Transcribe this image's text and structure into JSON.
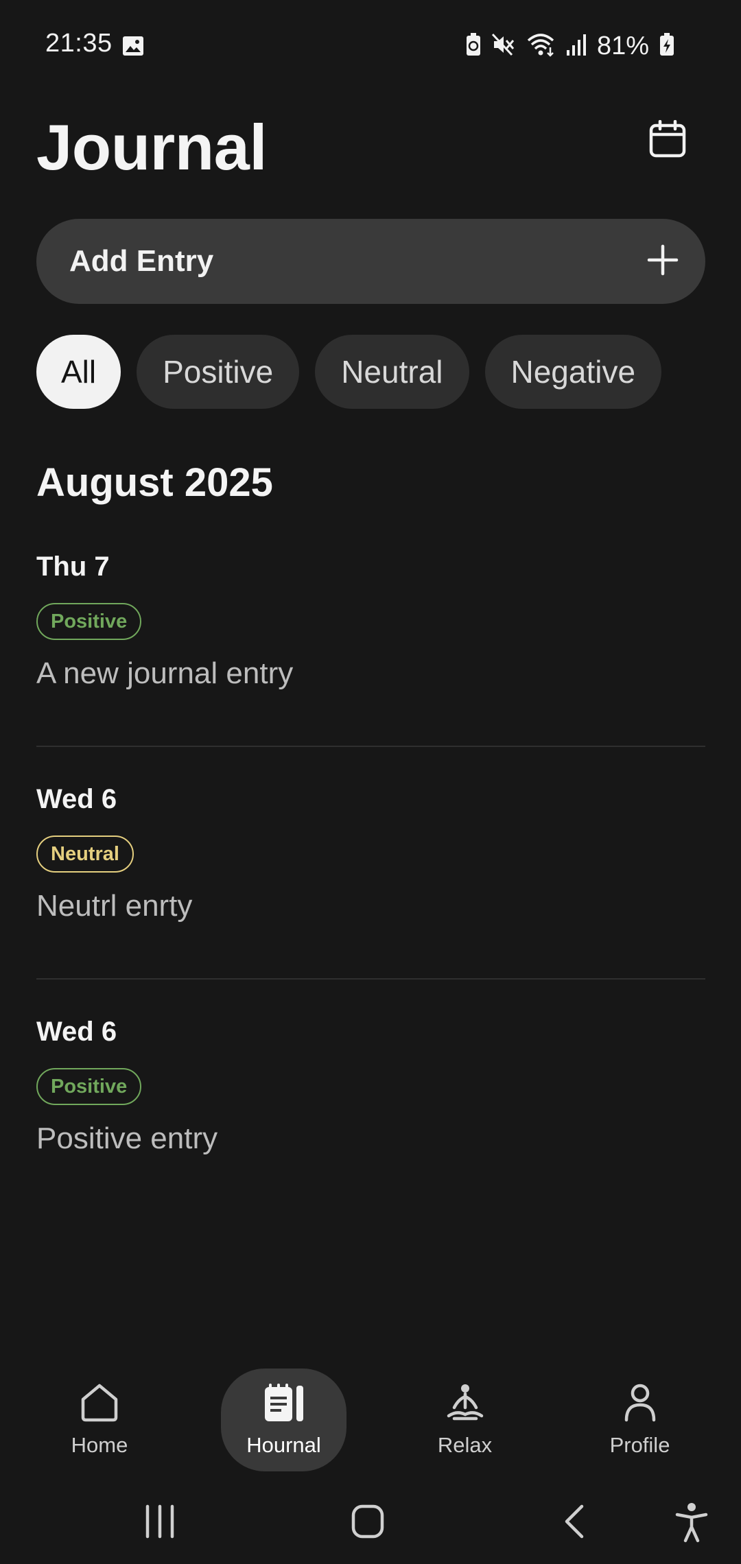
{
  "status_bar": {
    "time": "21:35",
    "battery_percent": "81%",
    "icons": [
      "image-icon",
      "battery-saver-icon",
      "mute-icon",
      "wifi-icon",
      "signal-icon",
      "battery-charging-icon"
    ]
  },
  "header": {
    "title": "Journal",
    "calendar_icon": "calendar-icon"
  },
  "add_entry": {
    "label": "Add Entry",
    "icon": "plus-icon"
  },
  "filters": [
    {
      "label": "All",
      "active": true
    },
    {
      "label": "Positive",
      "active": false
    },
    {
      "label": "Neutral",
      "active": false
    },
    {
      "label": "Negative",
      "active": false
    }
  ],
  "month": "August 2025",
  "entries": [
    {
      "date": "Thu 7",
      "mood": "Positive",
      "text": "A new journal entry"
    },
    {
      "date": "Wed 6",
      "mood": "Neutral",
      "text": "Neutrl enrty"
    },
    {
      "date": "Wed 6",
      "mood": "Positive",
      "text": "Positive entry"
    }
  ],
  "colors": {
    "background": "#171717",
    "positive": "#71a85c",
    "neutral": "#e5cf7f"
  },
  "bottom_nav": [
    {
      "label": "Home",
      "icon": "home-icon",
      "active": false
    },
    {
      "label": "Hournal",
      "icon": "journal-icon",
      "active": true
    },
    {
      "label": "Relax",
      "icon": "meditation-icon",
      "active": false
    },
    {
      "label": "Profile",
      "icon": "profile-icon",
      "active": false
    }
  ],
  "system_nav": {
    "icons": [
      "recent-apps-icon",
      "home-button-icon",
      "back-icon",
      "accessibility-icon"
    ]
  }
}
